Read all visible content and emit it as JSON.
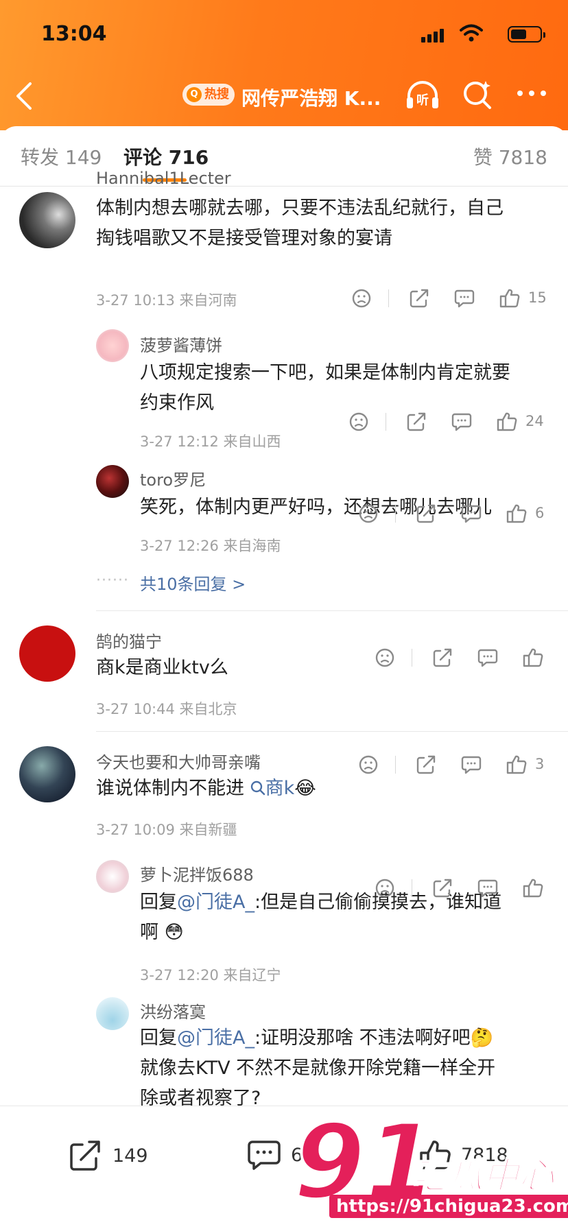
{
  "status_bar": {
    "time": "13:04"
  },
  "nav": {
    "hot_badge": "热搜",
    "title": "网传严浩翔 K...",
    "listen_label": "听"
  },
  "tabs": [
    {
      "label": "转发 149"
    },
    {
      "label": "评论 716"
    },
    {
      "label": "赞 7818"
    }
  ],
  "comments": [
    {
      "name": "Hannibal1Lecter",
      "text_line1": "体制内想去哪就去哪，只要不违法乱纪就行，自己",
      "text_line2": "掏钱唱歌又不是接受管理对象的宴请",
      "meta": "3-27 10:13  来自河南",
      "likes": "15"
    },
    {
      "name": "菠萝酱薄饼",
      "text_line1": "八项规定搜索一下吧，如果是体制内肯定就要",
      "text_line2": "约束作风",
      "meta": "3-27 12:12  来自山西",
      "likes": "24"
    },
    {
      "name": "toro罗尼",
      "text_line1": "笑死，体制内更严好吗，还想去哪儿去哪儿",
      "meta": "3-27 12:26  来自海南",
      "likes": "6"
    },
    {
      "more_replies": "共10条回复 >"
    },
    {
      "name": "鹄的猫宁",
      "text_line1": "商k是商业ktv么",
      "meta": "3-27 10:44  来自北京",
      "likes": ""
    },
    {
      "name": "今天也要和大帅哥亲嘴",
      "text_prefix": "谁说体制内不能进",
      "text_link": "商k",
      "emoji": "😂",
      "meta": "3-27 10:09  来自新疆",
      "likes": "3"
    },
    {
      "name": "萝卜泥拌饭688",
      "reply_prefix": "回复",
      "reply_at": "@门徒A_",
      "text_line1": ":但是自己偷偷摸摸去，谁知道",
      "text_line2": "啊",
      "emoji": "😳",
      "meta": "3-27 12:20  来自辽宁",
      "likes": ""
    },
    {
      "name": "洪纷落寞",
      "reply_prefix": "回复",
      "reply_at": "@门徒A_",
      "text_line1": ":证明没那啥 不违法啊好吧",
      "emoji": "🤔",
      "text_line2": "就像去KTV 不然不是就像开除党籍一样全开",
      "text_line3": "除或者视察了?"
    }
  ],
  "bottom_bar": {
    "repost": "149",
    "comment": "6",
    "like": "7818"
  },
  "watermark": {
    "big": "91",
    "cn": "吃瓜中心",
    "url": "https://91chigua23.com"
  },
  "colors": {
    "accent": "#ff8200",
    "link": "#4a6fa5",
    "header": "#ff7a1a",
    "watermark": "#e4205a"
  }
}
